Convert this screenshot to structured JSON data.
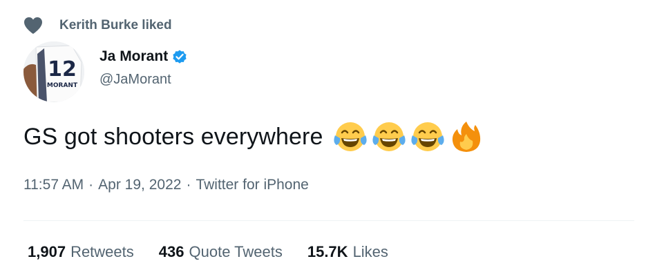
{
  "social_context": {
    "icon": "heart-icon",
    "text": "Kerith Burke liked"
  },
  "author": {
    "avatar_jersey_number": "12",
    "avatar_jersey_name": "MORANT",
    "display_name": "Ja Morant",
    "verified": true,
    "handle": "@JaMorant"
  },
  "tweet": {
    "text": "GS got shooters everywhere",
    "emojis": [
      "face-with-tears-of-joy-icon",
      "face-with-tears-of-joy-icon",
      "face-with-tears-of-joy-icon",
      "fire-icon"
    ]
  },
  "meta": {
    "time": "11:57 AM",
    "separator": "·",
    "date": "Apr 19, 2022",
    "source": "Twitter for iPhone"
  },
  "stats": {
    "retweets_count": "1,907",
    "retweets_label": "Retweets",
    "quotes_count": "436",
    "quotes_label": "Quote Tweets",
    "likes_count": "15.7K",
    "likes_label": "Likes"
  },
  "colors": {
    "text_primary": "#0f1419",
    "text_secondary": "#536471",
    "verified_blue": "#1d9bf0",
    "divider": "#eff3f4"
  }
}
